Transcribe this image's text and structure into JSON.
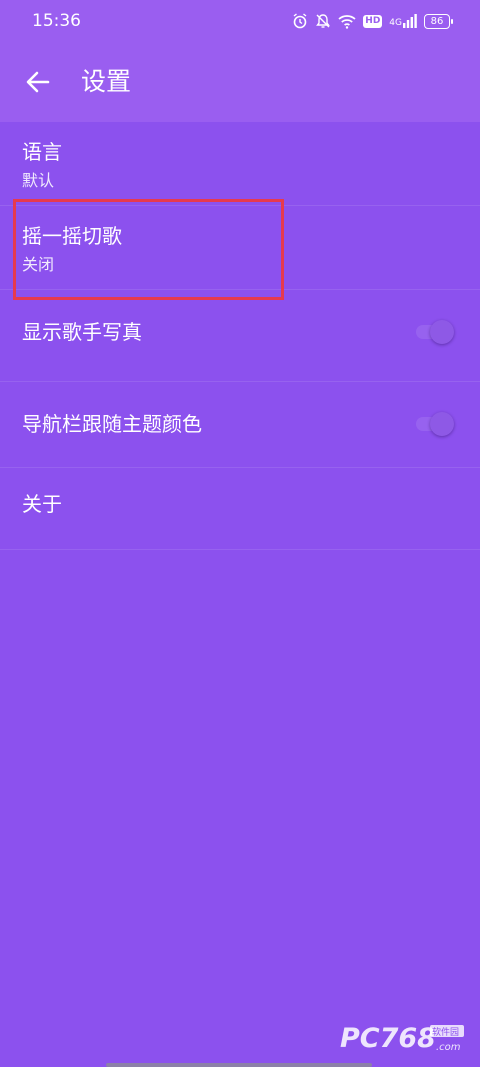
{
  "status_bar": {
    "time": "15:36",
    "hd": "HD",
    "network": "4G",
    "battery": "86",
    "icons": [
      "alarm-icon",
      "mute-icon",
      "wifi-icon",
      "hd-icon",
      "signal-icon",
      "battery-icon"
    ]
  },
  "app_bar": {
    "back_icon": "arrow-back-icon",
    "title": "设置"
  },
  "settings": {
    "language": {
      "title": "语言",
      "subtitle": "默认"
    },
    "shake": {
      "title": "摇一摇切歌",
      "subtitle": "关闭"
    },
    "singer_photo": {
      "title": "显示歌手写真",
      "enabled": false
    },
    "navbar_color": {
      "title": "导航栏跟随主题颜色",
      "enabled": false
    },
    "about": {
      "title": "关于"
    }
  },
  "watermark": {
    "text": "PC768",
    "suffix": ".com",
    "tag": "软件园"
  },
  "colors": {
    "background": "#8c51ee",
    "app_bar": "#9a5ef0",
    "highlight": "#e63a4e"
  }
}
